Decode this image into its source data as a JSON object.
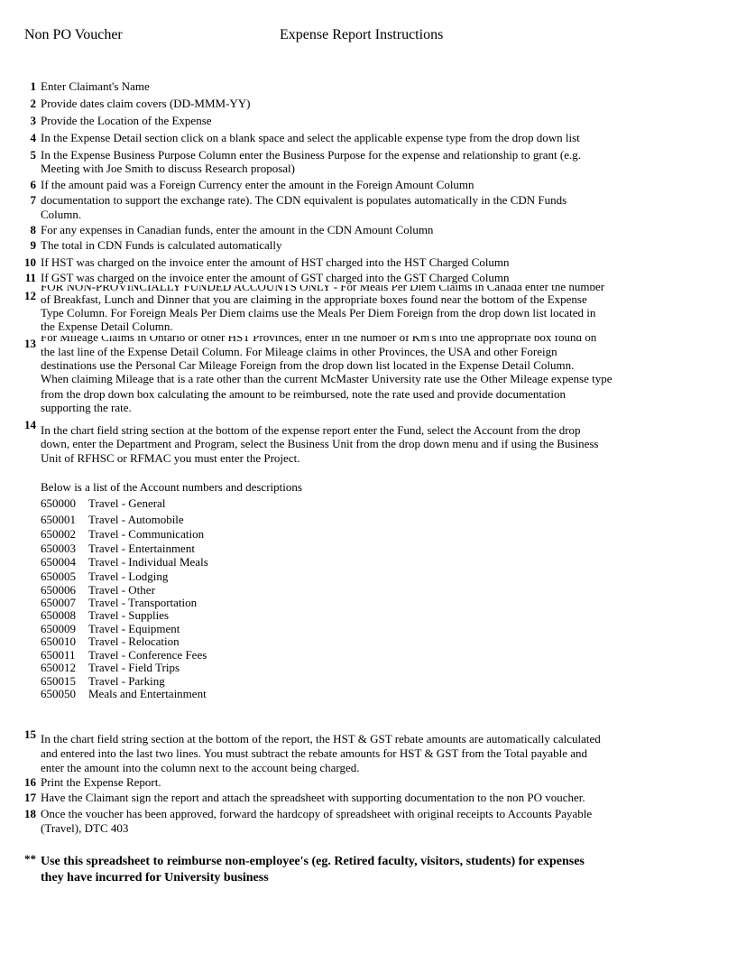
{
  "header": {
    "left": "Non PO Voucher",
    "center": "Expense Report Instructions"
  },
  "items": [
    {
      "num": "1",
      "lines": [
        "Enter Claimant's Name"
      ]
    },
    {
      "num": "2",
      "lines": [
        "Provide dates claim covers (DD-MMM-YY)"
      ]
    },
    {
      "num": "3",
      "lines": [
        "Provide the Location of the Expense"
      ]
    },
    {
      "num": "4",
      "lines": [
        "In the Expense Detail section click on a blank space and select the applicable expense type from the drop down list"
      ]
    },
    {
      "num": "5",
      "lines": [
        "In the Expense Business Purpose Column enter the Business Purpose for the expense and relationship to grant (e.g.",
        "Meeting with Joe Smith to discuss Research proposal)"
      ]
    },
    {
      "num": "6",
      "lines": [
        "If the amount paid was a Foreign Currency enter the amount in the Foreign Amount Column"
      ]
    },
    {
      "num": "7",
      "lines": [
        "documentation to support the exchange rate).  The CDN equivalent is populates automatically in the CDN Funds",
        "Column."
      ]
    },
    {
      "num": "8",
      "lines": [
        "For any expenses in Canadian funds, enter the amount in the CDN Amount Column"
      ]
    },
    {
      "num": "9",
      "lines": [
        "The total in CDN Funds is calculated automatically"
      ]
    },
    {
      "num": "10",
      "lines": [
        "If HST was charged on the invoice enter the amount of HST charged into the HST Charged Column"
      ]
    },
    {
      "num": "11",
      "lines": [
        "If GST was charged on the invoice enter the amount of GST charged into the GST Charged Column"
      ]
    },
    {
      "num": "12",
      "lines": [
        "FOR NON-PROVINCIALLY FUNDED ACCOUNTS ONLY - For Meals Per Diem Claims in Canada enter the number",
        "of Breakfast, Lunch and Dinner that you are claiming in the appropriate boxes found near the bottom of the Expense",
        "Type Column.  For Foreign Meals Per Diem claims use the Meals Per Diem Foreign from the drop down list located in",
        "the Expense Detail Column."
      ]
    },
    {
      "num": "13",
      "lines": [
        "For Mileage Claims in Ontario or other HST Provinces, enter in the number of Km's into the appropriate box found on",
        "the last line of the Expense Detail Column.  For Mileage claims in other Provinces, the USA and other Foreign",
        "destinations use the Personal Car Mileage Foreign from the drop down list located in the Expense Detail Column.",
        "When claiming Mileage that is a rate other than the current McMaster University rate use the Other Mileage expense type",
        "from the drop down box calculating the amount to be reimbursed, note the rate used and provide documentation",
        "supporting the rate."
      ]
    },
    {
      "num": "14",
      "lines": [
        "In the chart field string section at the bottom of the expense report enter the Fund, select the Account from the drop",
        "down, enter the Department and Program, select the Business Unit from the drop down menu and if using the Business",
        "Unit of RFHSC or RFMAC you must enter the Project."
      ]
    },
    {
      "num": "15",
      "lines": [
        "In the chart field string section at the bottom of the report, the HST & GST rebate amounts are automatically calculated",
        "and entered into the last two lines.  You must subtract the rebate amounts for HST & GST from the Total payable and",
        "enter the amount into the column next to the account being charged."
      ]
    },
    {
      "num": "16",
      "lines": [
        "Print the Expense Report."
      ]
    },
    {
      "num": "17",
      "lines": [
        "Have the Claimant sign the report and attach the spreadsheet with supporting documentation to the non PO voucher."
      ]
    },
    {
      "num": "18",
      "lines": [
        "Once the voucher has been approved, forward the hardcopy of spreadsheet with original receipts to Accounts Payable",
        "(Travel), DTC 403"
      ]
    }
  ],
  "accounts_intro": "Below is a list of the Account numbers and descriptions",
  "accounts": [
    {
      "code": "650000",
      "desc": "Travel - General"
    },
    {
      "code": "650001",
      "desc": "Travel - Automobile"
    },
    {
      "code": "650002",
      "desc": "Travel - Communication"
    },
    {
      "code": "650003",
      "desc": "Travel - Entertainment"
    },
    {
      "code": "650004",
      "desc": "Travel - Individual Meals"
    },
    {
      "code": "650005",
      "desc": "Travel - Lodging"
    },
    {
      "code": "650006",
      "desc": "Travel - Other"
    },
    {
      "code": "650007",
      "desc": "Travel - Transportation"
    },
    {
      "code": "650008",
      "desc": "Travel - Supplies"
    },
    {
      "code": "650009",
      "desc": "Travel - Equipment"
    },
    {
      "code": "650010",
      "desc": "Travel - Relocation"
    },
    {
      "code": "650011",
      "desc": "Travel - Conference Fees"
    },
    {
      "code": "650012",
      "desc": "Travel - Field Trips"
    },
    {
      "code": "650015",
      "desc": "Travel - Parking"
    },
    {
      "code": "650050",
      "desc": "Meals and Entertainment"
    }
  ],
  "note": {
    "marker": "**",
    "lines": [
      "Use this spreadsheet to reimburse non-employee's (eg. Retired faculty, visitors, students) for expenses",
      "they have incurred for University business"
    ]
  }
}
